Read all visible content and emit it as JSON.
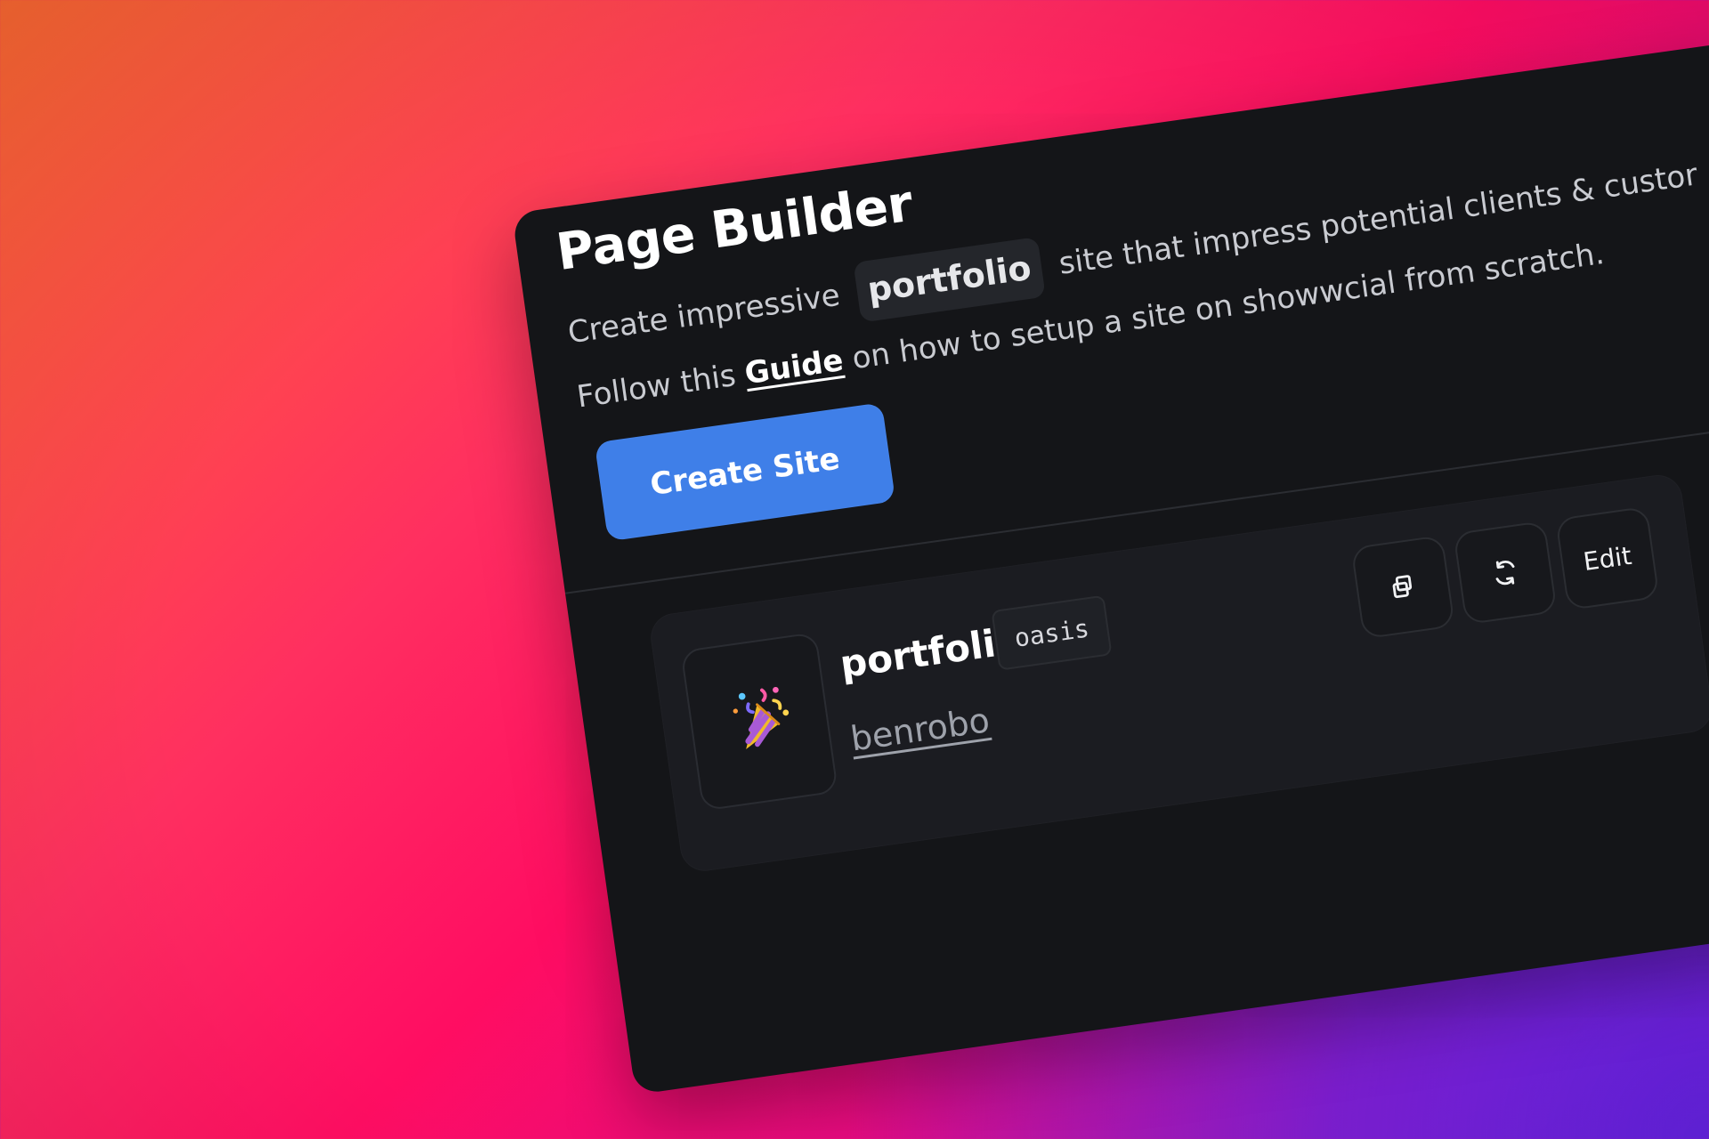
{
  "header": {
    "title": "Page Builder",
    "description_prefix": "Create impressive",
    "description_chip": "portfolio",
    "description_suffix": "site that impress potential clients & custor",
    "guide_prefix": "Follow this",
    "guide_link": "Guide",
    "guide_suffix": "on how to setup a site on showwcial from scratch."
  },
  "actions": {
    "create_site": "Create Site"
  },
  "site": {
    "name": "portfolio",
    "theme": "oasis",
    "user": "benrobo",
    "thumbnail_icon": "party-popper-icon",
    "edit_label": "Edit",
    "duplicate_icon": "duplicate-icon",
    "refresh_icon": "refresh-icon"
  },
  "colors": {
    "panel": "#141518",
    "button": "#3f7fe8",
    "card": "#1b1c21"
  }
}
